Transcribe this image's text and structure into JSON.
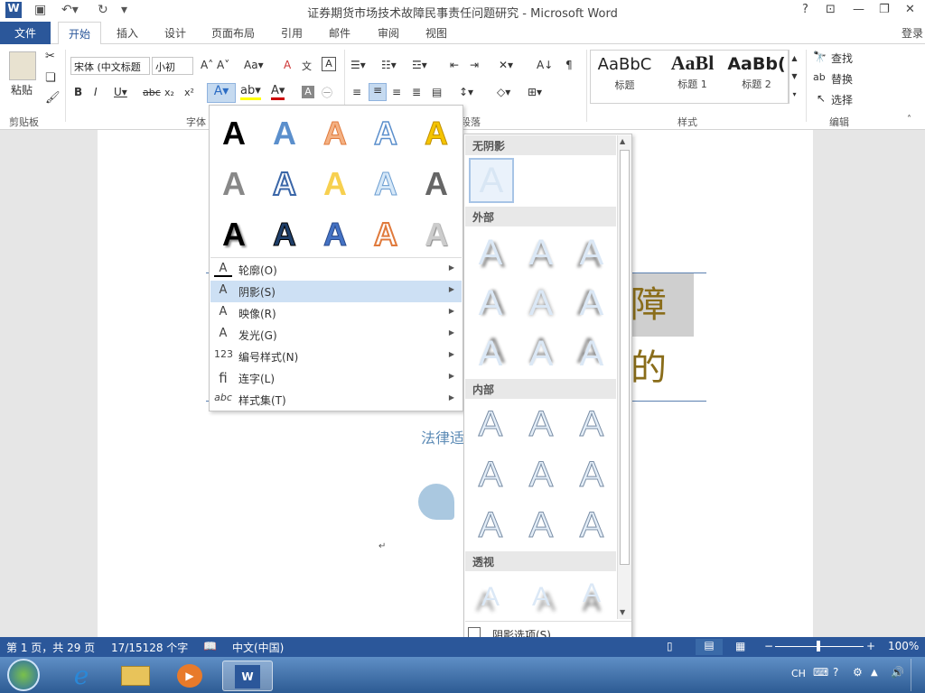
{
  "window": {
    "title": "证券期货市场技术故障民事责任问题研究 - Microsoft Word",
    "help": "?",
    "login": "登录"
  },
  "tabs": [
    "文件",
    "开始",
    "插入",
    "设计",
    "页面布局",
    "引用",
    "邮件",
    "审阅",
    "视图"
  ],
  "ribbon": {
    "paste": "粘贴",
    "font_name": "宋体 (中文标题",
    "font_size": "小初",
    "groups": {
      "clipboard": "剪贴板",
      "font": "字体",
      "paragraph": "段落",
      "styles": "样式",
      "editing": "编辑"
    },
    "styles": [
      {
        "preview": "AaBbC",
        "name": "标题"
      },
      {
        "preview": "AaBl",
        "name": "标题 1"
      },
      {
        "preview": "AaBb(",
        "name": "标题 2"
      }
    ],
    "editing": {
      "find": "查找",
      "replace": "替换",
      "select": "选择"
    }
  },
  "text_effects_menu": {
    "items": [
      {
        "label": "轮廓(O)",
        "icon": "A"
      },
      {
        "label": "阴影(S)",
        "icon": "A"
      },
      {
        "label": "映像(R)",
        "icon": "A"
      },
      {
        "label": "发光(G)",
        "icon": "A"
      },
      {
        "label": "编号样式(N)",
        "icon": "123"
      },
      {
        "label": "连字(L)",
        "icon": "fi"
      },
      {
        "label": "样式集(T)",
        "icon": "abc"
      }
    ]
  },
  "shadow_menu": {
    "sections": [
      "无阴影",
      "外部",
      "内部",
      "透视"
    ],
    "options": "阴影选项(S)..."
  },
  "document": {
    "heading_fragment": "障的",
    "subtitle_fragment": "法律适",
    "para_mark": "↵"
  },
  "status": {
    "page": "第 1 页，共 29 页",
    "words": "17/15128 个字",
    "lang": "中文(中国)",
    "zoom": "100%"
  },
  "tray": {
    "ime": "CH"
  }
}
